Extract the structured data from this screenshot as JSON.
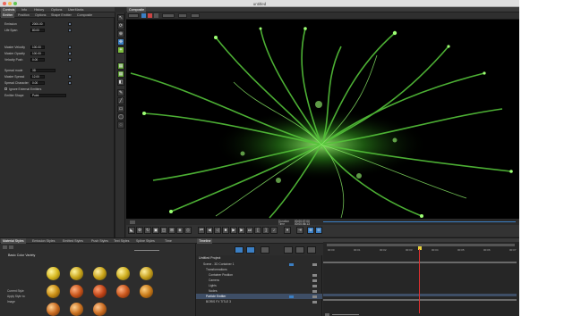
{
  "window": {
    "title": "untitled"
  },
  "left_panel": {
    "tabs": [
      "Controls",
      "Info",
      "History",
      "Options",
      "UserMarks"
    ],
    "sub_tabs": [
      "Emitter",
      "Position",
      "Options",
      "Shape Emitter",
      "Composite"
    ],
    "params": [
      {
        "label": "Emission",
        "value": "2000.00"
      },
      {
        "label": "Life Span",
        "value": "80.00"
      },
      {
        "label": "Master Velocity",
        "value": "100.00"
      },
      {
        "label": "Master Opacity",
        "value": "100.00"
      },
      {
        "label": "Velocity Push",
        "value": "0.00"
      },
      {
        "label": "Spread mode",
        "value": "3D"
      },
      {
        "label": "Master Spread",
        "value": "12.00"
      },
      {
        "label": "Spread Character",
        "value": "0.00"
      },
      {
        "label": "Ignore External Emitters",
        "value": ""
      },
      {
        "label": "Emitter Shape",
        "value": "Point"
      }
    ]
  },
  "viewer": {
    "tabs": [
      "Composite"
    ],
    "duration_label": "Duration",
    "duration_value": "00:00:07:00",
    "time_label": "Time",
    "time_value": "00:00:06:13"
  },
  "styles_panel": {
    "tabs": [
      "Material Styles",
      "Emission Styles",
      "Emitted Styles",
      "Push Styles",
      "Text Styles",
      "Spline Styles",
      "Time"
    ],
    "heading": "Basic Color Variety",
    "labels": [
      "Current Style",
      "Apply Style to:",
      "Image"
    ]
  },
  "timeline": {
    "tab": "Timeline",
    "project": "Untitled Project",
    "tracks": [
      "Scene - 3D Container 1",
      "Transformations",
      "Container Position",
      "Camera",
      "Lights",
      "Nodes",
      "Particle Emitter",
      "BORIS FX TITLE 3"
    ],
    "ticks": [
      "00:00",
      "00:01",
      "00:02",
      "00:03",
      "00:04",
      "00:05",
      "00:06",
      "00:07"
    ]
  }
}
